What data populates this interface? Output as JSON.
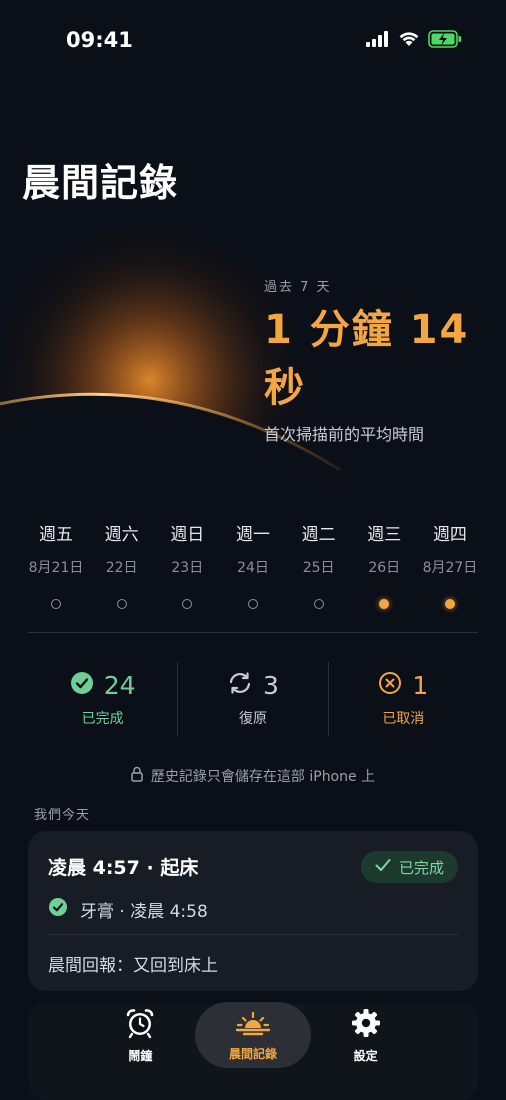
{
  "status": {
    "time": "09:41"
  },
  "page_title": "晨間記錄",
  "summary": {
    "period": "過去 7 天",
    "value": "1 分鐘 14 秒",
    "caption": "首次掃描前的平均時間"
  },
  "week": [
    {
      "name": "週五",
      "date": "8月21日",
      "active": false
    },
    {
      "name": "週六",
      "date": "22日",
      "active": false
    },
    {
      "name": "週日",
      "date": "23日",
      "active": false
    },
    {
      "name": "週一",
      "date": "24日",
      "active": false
    },
    {
      "name": "週二",
      "date": "25日",
      "active": false
    },
    {
      "name": "週三",
      "date": "26日",
      "active": true
    },
    {
      "name": "週四",
      "date": "8月27日",
      "active": true
    }
  ],
  "stats": {
    "completed": {
      "count": "24",
      "label": "已完成"
    },
    "restored": {
      "count": "3",
      "label": "復原"
    },
    "cancelled": {
      "count": "1",
      "label": "已取消"
    }
  },
  "privacy_note": "歷史記錄只會儲存在這部 iPhone 上",
  "section_label": "我們今天",
  "card": {
    "title": "凌晨 4:57 · 起床",
    "badge": "已完成",
    "item": "牙膏 · 凌晨 4:58",
    "report": "晨間回報：又回到床上"
  },
  "tabs": [
    {
      "label": "鬧鐘",
      "icon": "alarm-clock-icon"
    },
    {
      "label": "晨間記錄",
      "icon": "sunrise-icon"
    },
    {
      "label": "設定",
      "icon": "gear-icon"
    }
  ],
  "colors": {
    "accent": "#f4a640",
    "success": "#6fcf97",
    "background": "#0b0f17",
    "card": "#171c25"
  }
}
